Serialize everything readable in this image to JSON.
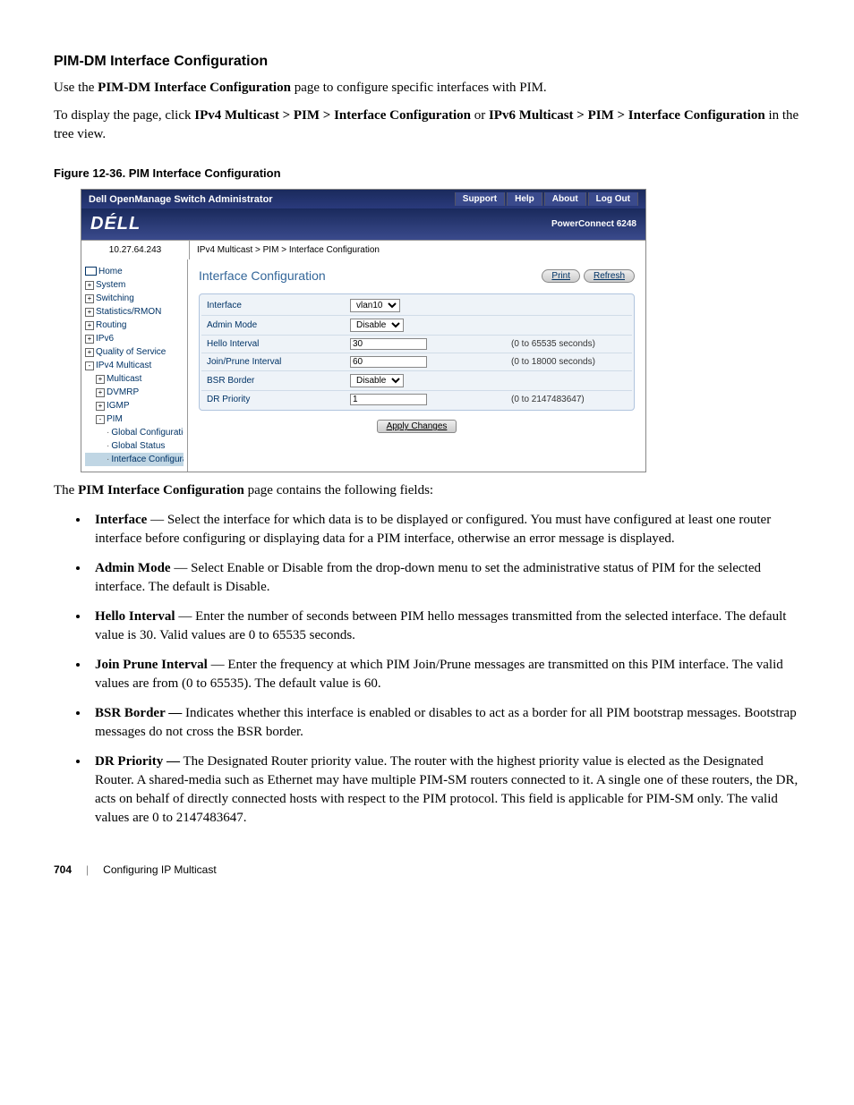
{
  "section_title": "PIM-DM Interface Configuration",
  "intro_p1_a": "Use the ",
  "intro_p1_b": "PIM-DM Interface Configuration",
  "intro_p1_c": " page to configure specific interfaces with PIM.",
  "intro_p2_a": "To display the page, click ",
  "intro_p2_b": "IPv4 Multicast > PIM > Interface Configuration",
  "intro_p2_c": " or ",
  "intro_p2_d": "IPv6 Multicast > PIM > Interface Configuration",
  "intro_p2_e": " in the tree view.",
  "figure_caption": "Figure 12-36.   PIM Interface Configuration",
  "app": {
    "header_title": "Dell OpenManage Switch Administrator",
    "links": {
      "support": "Support",
      "help": "Help",
      "about": "About",
      "logout": "Log Out"
    },
    "logo": "DÉLL",
    "device": "PowerConnect 6248",
    "ip": "10.27.64.243",
    "breadcrumb": "IPv4 Multicast > PIM > Interface Configuration"
  },
  "tree": {
    "home": "Home",
    "system": "System",
    "switching": "Switching",
    "statistics": "Statistics/RMON",
    "routing": "Routing",
    "ipv6": "IPv6",
    "qos": "Quality of Service",
    "ipv4m": "IPv4 Multicast",
    "multicast": "Multicast",
    "dvmrp": "DVMRP",
    "igmp": "IGMP",
    "pim": "PIM",
    "globalconf": "Global Configuration",
    "globalstatus": "Global Status",
    "intconf": "Interface Configurati"
  },
  "content": {
    "title": "Interface Configuration",
    "print": "Print",
    "refresh": "Refresh",
    "rows": {
      "interface": {
        "label": "Interface",
        "value": "vlan10"
      },
      "admin": {
        "label": "Admin Mode",
        "value": "Disable"
      },
      "hello": {
        "label": "Hello Interval",
        "value": "30",
        "hint": "(0 to 65535 seconds)"
      },
      "join": {
        "label": "Join/Prune Interval",
        "value": "60",
        "hint": "(0 to 18000 seconds)"
      },
      "bsr": {
        "label": "BSR Border",
        "value": "Disable"
      },
      "dr": {
        "label": "DR Priority",
        "value": "1",
        "hint": "(0 to 2147483647)"
      }
    },
    "apply": "Apply Changes"
  },
  "post_figure_a": "The ",
  "post_figure_b": "PIM Interface Configuration",
  "post_figure_c": " page contains the following fields:",
  "bullets": {
    "b1_term": "Interface",
    "b1_text": " — Select the interface for which data is to be displayed or configured. You must have configured at least one router interface before configuring or displaying data for a PIM interface, otherwise an error message is displayed.",
    "b2_term": "Admin Mode",
    "b2_text": " — Select Enable or Disable from the drop-down menu to set the administrative status of PIM for the selected interface. The default is Disable.",
    "b3_term": "Hello Interval",
    "b3_text": " — Enter the number of seconds between PIM hello messages transmitted from the selected interface. The default value is 30. Valid values are 0 to 65535 seconds.",
    "b4_term": "Join Prune Interval",
    "b4_text": " — Enter the frequency at which PIM Join/Prune messages are transmitted on this PIM interface. The valid values are from (0 to 65535). The default value is 60.",
    "b5_term": "BSR Border —",
    "b5_text": " Indicates whether this interface is enabled or disables to act as a border for all PIM bootstrap messages. Bootstrap messages do not cross the BSR border.",
    "b6_term": "DR Priority —",
    "b6_text": " The Designated Router priority value. The router with the highest priority value is elected as the Designated Router. A shared-media such as Ethernet may have multiple PIM-SM routers connected to it. A single one of these routers, the DR, acts on behalf of directly connected hosts with respect to the PIM protocol. This field is applicable for PIM-SM only. The valid values are 0 to 2147483647."
  },
  "footer": {
    "page": "704",
    "chapter": "Configuring IP Multicast"
  }
}
